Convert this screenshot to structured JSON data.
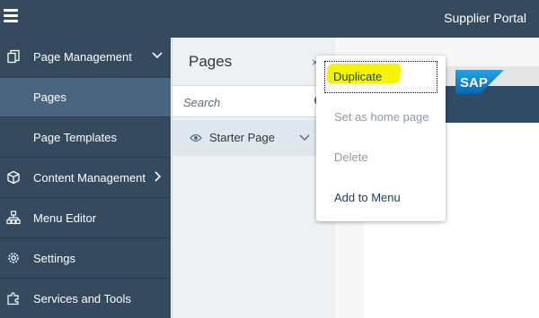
{
  "header": {
    "title": "Supplier Portal"
  },
  "sidebar": {
    "items": [
      {
        "label": "Page Management"
      },
      {
        "label": "Pages"
      },
      {
        "label": "Page Templates"
      },
      {
        "label": "Content Management"
      },
      {
        "label": "Menu Editor"
      },
      {
        "label": "Settings"
      },
      {
        "label": "Services and Tools"
      }
    ]
  },
  "pages_panel": {
    "title": "Pages",
    "search_placeholder": "Search",
    "page_item": "Starter Page"
  },
  "context_menu": {
    "items": [
      {
        "label": "Duplicate",
        "state": "focused"
      },
      {
        "label": "Set as home page",
        "state": "disabled"
      },
      {
        "label": "Delete",
        "state": "disabled"
      },
      {
        "label": "Add to Menu",
        "state": "enabled"
      }
    ]
  },
  "canvas": {
    "logo": "SAP"
  },
  "colors": {
    "shell": "#354a5f",
    "selected_nav": "#4a6580",
    "highlight": "#f5f500",
    "brand_blue": "#1a8ad6"
  }
}
